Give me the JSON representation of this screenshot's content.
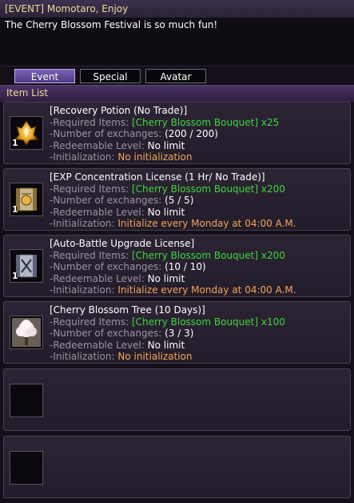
{
  "title": "[EVENT] Momotaro, Enjoy",
  "message": "The Cherry Blossom Festival is so much fun!",
  "tabs": [
    {
      "label": "Event",
      "active": true
    },
    {
      "label": "Special",
      "active": false
    },
    {
      "label": "Avatar",
      "active": false
    }
  ],
  "section_title": "Item List",
  "labels": {
    "required": "-Required Items:",
    "exchanges": "-Number of exchanges:",
    "level": "-Redeemable Level:",
    "init": "-Initialization:"
  },
  "items": [
    {
      "name": "[Recovery Potion (No Trade)]",
      "required": "[Cherry Blossom Bouquet] x25",
      "exchanges": "(200 / 200)",
      "level": "No limit",
      "init": "No initialization",
      "qty": "1",
      "icon": "potion-icon"
    },
    {
      "name": "[EXP Concentration License (1 Hr/ No Trade)]",
      "required": "[Cherry Blossom Bouquet] x200",
      "exchanges": "(5 / 5)",
      "level": "No limit",
      "init": "Initialize every Monday at 04:00 A.M.",
      "qty": "1",
      "icon": "exp-license-icon"
    },
    {
      "name": "[Auto-Battle Upgrade License]",
      "required": "[Cherry Blossom Bouquet] x200",
      "exchanges": "(10 / 10)",
      "level": "No limit",
      "init": "Initialize every Monday at 04:00 A.M.",
      "qty": "1",
      "icon": "auto-battle-license-icon"
    },
    {
      "name": "[Cherry Blossom Tree (10 Days)]",
      "required": "[Cherry Blossom Bouquet] x100",
      "exchanges": "(3 / 3)",
      "level": "No limit",
      "init": "No initialization",
      "qty": "",
      "icon": "cherry-tree-icon"
    }
  ],
  "colors": {
    "green": "#3ed63e",
    "orange": "#f2a65a",
    "gold": "#f0d79a",
    "tab_active": "#6a52a8"
  }
}
